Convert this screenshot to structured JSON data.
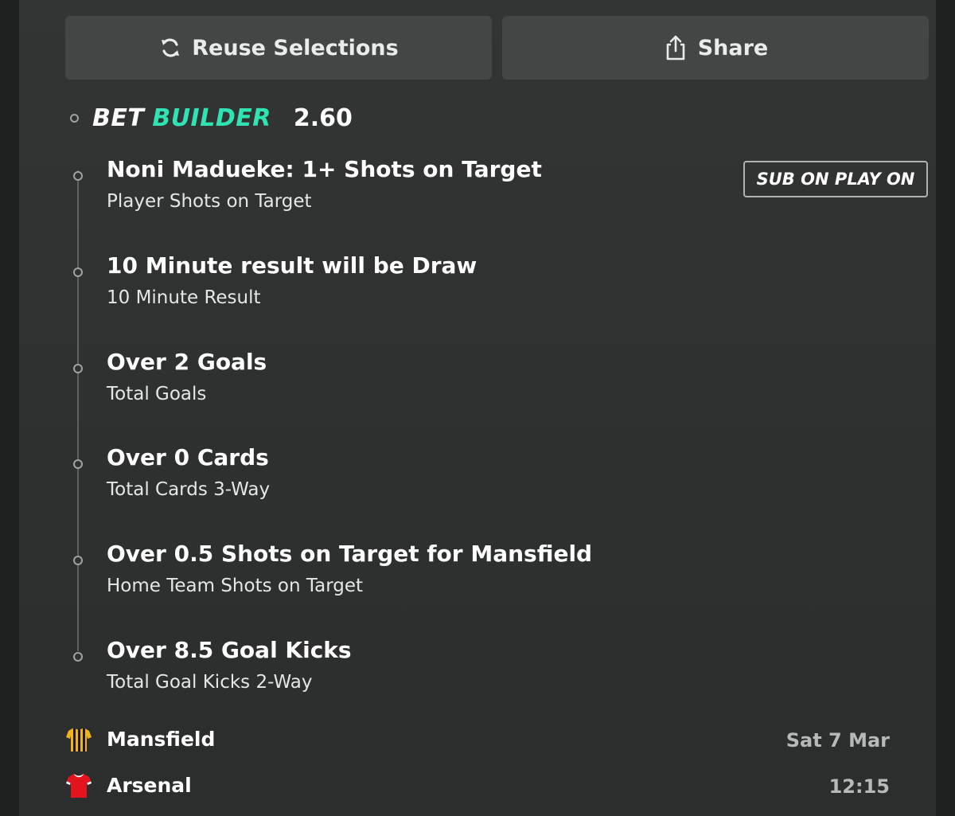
{
  "actions": {
    "reuse_label": "Reuse Selections",
    "reuse_icon": "refresh-icon",
    "share_label": "Share",
    "share_icon": "share-icon"
  },
  "bet_builder": {
    "label_part1": "BET",
    "label_part2": "BUILDER",
    "odds": "2.60",
    "accent_color": "#2fe3b2"
  },
  "legs": [
    {
      "title": "Noni Madueke: 1+ Shots on Target",
      "market": "Player Shots on Target",
      "badge": "SUB ON PLAY ON"
    },
    {
      "title": "10 Minute result will be Draw",
      "market": "10 Minute Result"
    },
    {
      "title": "Over 2 Goals",
      "market": "Total Goals"
    },
    {
      "title": "Over 0 Cards",
      "market": "Total Cards 3-Way"
    },
    {
      "title": "Over 0.5 Shots on Target for Mansfield",
      "market": "Home Team Shots on Target"
    },
    {
      "title": "Over 8.5 Goal Kicks",
      "market": "Total Goal Kicks 2-Way"
    }
  ],
  "match": {
    "home": {
      "name": "Mansfield",
      "icon": "amber-striped-shirt-icon"
    },
    "away": {
      "name": "Arsenal",
      "icon": "red-shirt-icon"
    },
    "date": "Sat 7 Mar",
    "time": "12:15"
  }
}
